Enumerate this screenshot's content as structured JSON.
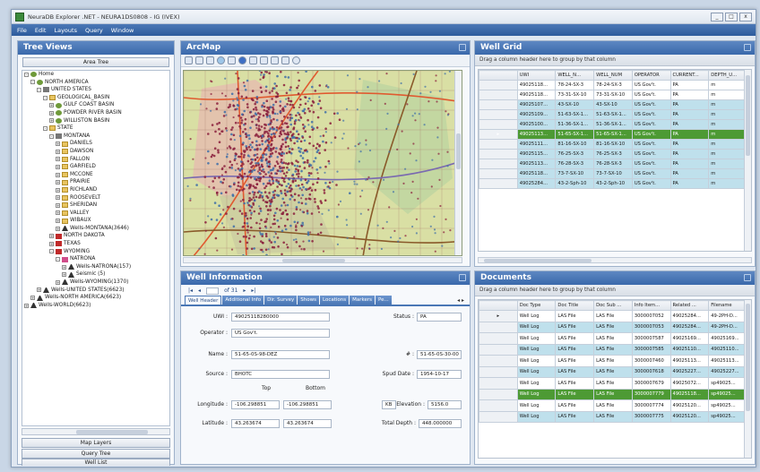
{
  "window": {
    "title": "NeuraDB Explorer .NET - NEURA1DS0808 - IG (IVEX)",
    "controls": [
      "_",
      "□",
      "x"
    ]
  },
  "menu": [
    "File",
    "Edit",
    "Layouts",
    "Query",
    "Window"
  ],
  "tree_views": {
    "title": "Tree Views",
    "tab_label": "Area Tree",
    "items": [
      {
        "indent": 0,
        "exp": "-",
        "icon": "globe",
        "label": "Home"
      },
      {
        "indent": 1,
        "exp": "-",
        "icon": "globe",
        "label": "NORTH AMERICA"
      },
      {
        "indent": 2,
        "exp": "-",
        "icon": "flag",
        "label": "UNITED STATES"
      },
      {
        "indent": 3,
        "exp": "-",
        "icon": "folder",
        "label": "GEOLOGICAL_BASIN"
      },
      {
        "indent": 4,
        "exp": "+",
        "icon": "leaf",
        "label": "GULF COAST BASIN"
      },
      {
        "indent": 4,
        "exp": "+",
        "icon": "leaf",
        "label": "POWDER RIVER BASIN"
      },
      {
        "indent": 4,
        "exp": "+",
        "icon": "leaf",
        "label": "WILLISTON BASIN"
      },
      {
        "indent": 3,
        "exp": "-",
        "icon": "folder",
        "label": "STATE"
      },
      {
        "indent": 4,
        "exp": "-",
        "icon": "flag",
        "label": "MONTANA"
      },
      {
        "indent": 5,
        "exp": "+",
        "icon": "folder",
        "label": "DANIELS"
      },
      {
        "indent": 5,
        "exp": "+",
        "icon": "folder",
        "label": "DAWSON"
      },
      {
        "indent": 5,
        "exp": "+",
        "icon": "folder",
        "label": "FALLON"
      },
      {
        "indent": 5,
        "exp": "+",
        "icon": "folder",
        "label": "GARFIELD"
      },
      {
        "indent": 5,
        "exp": "+",
        "icon": "folder",
        "label": "MCCONE"
      },
      {
        "indent": 5,
        "exp": "+",
        "icon": "folder",
        "label": "PRAIRIE"
      },
      {
        "indent": 5,
        "exp": "+",
        "icon": "folder",
        "label": "RICHLAND"
      },
      {
        "indent": 5,
        "exp": "+",
        "icon": "folder",
        "label": "ROOSEVELT"
      },
      {
        "indent": 5,
        "exp": "+",
        "icon": "folder",
        "label": "SHERIDAN"
      },
      {
        "indent": 5,
        "exp": "+",
        "icon": "folder",
        "label": "VALLEY"
      },
      {
        "indent": 5,
        "exp": "+",
        "icon": "folder",
        "label": "WIBAUX"
      },
      {
        "indent": 5,
        "exp": "+",
        "icon": "well",
        "label": "Wells-MONTANA(3646)"
      },
      {
        "indent": 4,
        "exp": "+",
        "icon": "red",
        "label": "NORTH DAKOTA"
      },
      {
        "indent": 4,
        "exp": "+",
        "icon": "red",
        "label": "TEXAS"
      },
      {
        "indent": 4,
        "exp": "-",
        "icon": "red",
        "label": "WYOMING"
      },
      {
        "indent": 5,
        "exp": "-",
        "icon": "pink",
        "label": "NATRONA"
      },
      {
        "indent": 6,
        "exp": "+",
        "icon": "well",
        "label": "Wells-NATRONA(157)"
      },
      {
        "indent": 6,
        "exp": "+",
        "icon": "well",
        "label": "Seismic (5)"
      },
      {
        "indent": 5,
        "exp": "+",
        "icon": "well",
        "label": "Wells-WYOMING(1370)"
      },
      {
        "indent": 2,
        "exp": "+",
        "icon": "well",
        "label": "Wells-UNITED STATES(6623)"
      },
      {
        "indent": 1,
        "exp": "+",
        "icon": "well",
        "label": "Wells-NORTH AMERICA(6623)"
      },
      {
        "indent": 0,
        "exp": "+",
        "icon": "well",
        "label": "Wells-WORLD(6623)"
      }
    ],
    "bottom_buttons": [
      "Map Layers",
      "Query Tree",
      "Well List"
    ]
  },
  "arcmap": {
    "title": "ArcMap",
    "tools": [
      "zoom-in",
      "zoom-out",
      "pan",
      "globe",
      "identify",
      "info",
      "select",
      "measure",
      "table",
      "print",
      "refresh"
    ]
  },
  "well_info": {
    "title": "Well Information",
    "record_label": "of 31",
    "tabs": [
      "Well Header",
      "Additional Info",
      "Dir. Survey",
      "Shows",
      "Locations",
      "Markers",
      "Pe..."
    ],
    "fields": {
      "uwi_label": "UWI :",
      "uwi": "49025118280000",
      "status_label": "Status :",
      "status": "PA",
      "operator_label": "Operator :",
      "operator": "US Gov't.",
      "name_label": "Name :",
      "name": "51-65-0S-98-DEZ",
      "num_label": "# :",
      "num": "51-65-0S-30-00",
      "source_label": "Source :",
      "source": "BHOTC",
      "spud_label": "Spud Date :",
      "spud": "1954-10-17",
      "top_label": "Top",
      "bottom_label": "Bottom",
      "long_label": "Longitude :",
      "long_top": "-106.298851",
      "long_bot": "-106.298851",
      "kb_label": "KB",
      "elev_label": "Elevation :",
      "elev": "5156.0",
      "lat_label": "Latitude :",
      "lat_top": "43.263674",
      "lat_bot": "43.263674",
      "td_label": "Total Depth :",
      "td": "448.000000"
    }
  },
  "well_grid": {
    "title": "Well Grid",
    "group_hint": "Drag a column header here to group by that column",
    "columns": [
      "UWI",
      "WELL_N...",
      "WELL_NUM",
      "OPERATOR",
      "CURRENT...",
      "DEPTH_U..."
    ],
    "rows": [
      [
        "49025118...",
        "78-24-SX-3",
        "78-24-SX-3",
        "US Gov't.",
        "PA",
        "m"
      ],
      [
        "49025118...",
        "73-31-SX-10",
        "73-31-SX-10",
        "US Gov't.",
        "PA",
        "m"
      ],
      [
        "49025107...",
        "43-SX-10",
        "43-SX-10",
        "US Gov't.",
        "PA",
        "m"
      ],
      [
        "49025109...",
        "51-63-SX-1...",
        "51-63-SX-1...",
        "US Gov't.",
        "PA",
        "m"
      ],
      [
        "49025100...",
        "51-36-SX-1...",
        "51-36-SX-1...",
        "US Gov't.",
        "PA",
        "m"
      ],
      [
        "49025113...",
        "51-65-SX-1...",
        "51-65-SX-1...",
        "US Gov't.",
        "PA",
        "m"
      ],
      [
        "49025111...",
        "81-16-SX-10",
        "81-16-SX-10",
        "US Gov't.",
        "PA",
        "m"
      ],
      [
        "49025115...",
        "76-25-SX-3",
        "76-25-SX-3",
        "US Gov't.",
        "PA",
        "m"
      ],
      [
        "49025113...",
        "76-28-SX-3",
        "76-28-SX-3",
        "US Gov't.",
        "PA",
        "m"
      ],
      [
        "49025118...",
        "73-7-SX-10",
        "73-7-SX-10",
        "US Gov't.",
        "PA",
        "m"
      ],
      [
        "49025284...",
        "43-2-Sph-10",
        "43-2-Sph-10",
        "US Gov't.",
        "PA",
        "m"
      ]
    ],
    "selected_row": 5
  },
  "documents": {
    "title": "Documents",
    "group_hint": "Drag a column header here to group by that column",
    "columns": [
      "Doc Type",
      "Doc Title",
      "Doc Sub ...",
      "Info Item...",
      "Related ...",
      "Filename"
    ],
    "rows": [
      [
        "Well Log",
        "LAS File",
        "LAS File",
        "3000007052",
        "49025284...",
        "49-2PH-D..."
      ],
      [
        "Well Log",
        "LAS File",
        "LAS File",
        "3000007053",
        "49025284...",
        "49-2PH-D..."
      ],
      [
        "Well Log",
        "LAS File",
        "LAS File",
        "3000007587",
        "49025169...",
        "49025169..."
      ],
      [
        "Well Log",
        "LAS File",
        "LAS File",
        "3000007585",
        "49025110...",
        "49025110..."
      ],
      [
        "Well Log",
        "LAS File",
        "LAS File",
        "3000007460",
        "49025113...",
        "49025113..."
      ],
      [
        "Well Log",
        "LAS File",
        "LAS File",
        "3000007618",
        "49025227...",
        "49025227..."
      ],
      [
        "Well Log",
        "LAS File",
        "LAS File",
        "3000007679",
        "49025072...",
        "sp49025..."
      ],
      [
        "Well Log",
        "LAS File",
        "LAS File",
        "3000007779",
        "49025118...",
        "sp49025..."
      ],
      [
        "Well Log",
        "LAS File",
        "LAS File",
        "3000007774",
        "49025120...",
        "sp49025..."
      ],
      [
        "Well Log",
        "LAS File",
        "LAS File",
        "3000007775",
        "49025120...",
        "sp49025..."
      ]
    ],
    "selected_row": 7,
    "current_row": 0
  }
}
